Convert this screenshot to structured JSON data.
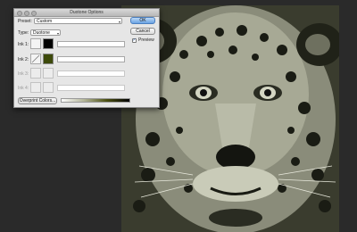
{
  "dialog": {
    "title": "Duotone Options",
    "preset_label": "Preset:",
    "preset_value": "Custom",
    "type_label": "Type:",
    "type_value": "Duotone",
    "ok_label": "OK",
    "cancel_label": "Cancel",
    "preview_label": "Preview",
    "preview_checked": true,
    "overprint_label": "Overprint Colors...",
    "inks": [
      {
        "label": "Ink 1:",
        "color": "#000000",
        "name": "",
        "enabled": true
      },
      {
        "label": "Ink 2:",
        "color": "#3d4a0a",
        "name": "",
        "enabled": true
      },
      {
        "label": "Ink 3:",
        "color": "",
        "name": "",
        "enabled": false
      },
      {
        "label": "Ink 4:",
        "color": "",
        "name": "",
        "enabled": false
      }
    ]
  },
  "image": {
    "subject": "jaguar-face",
    "tint_color": "#3b3d30"
  }
}
